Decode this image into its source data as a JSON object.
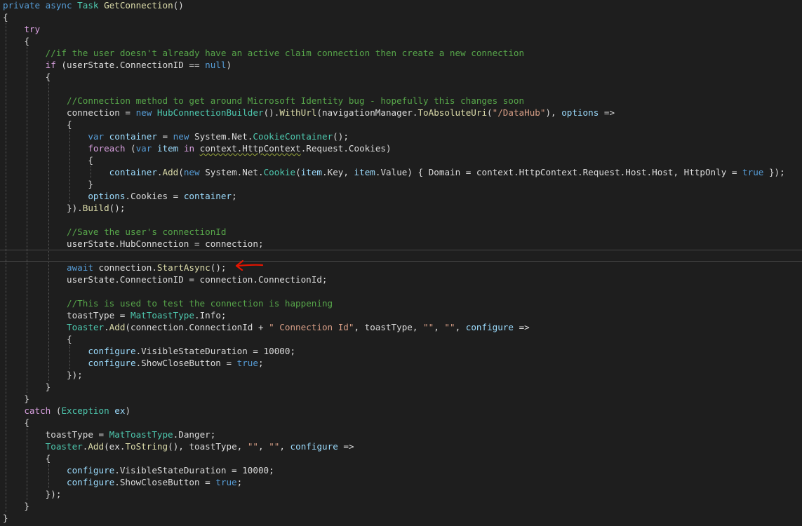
{
  "editor": {
    "colors": {
      "background": "#1e1e1e",
      "plain": "#dcdcdc",
      "keyword": "#569cd6",
      "control": "#d8a0df",
      "type": "#4ec9b0",
      "method": "#dcdcaa",
      "string": "#d69d85",
      "comment": "#57a64a",
      "param": "#9cdcfe",
      "local": "#9cdcfe",
      "number": "#b5cea8",
      "arrow": "#e51400"
    },
    "current_line_index": 21,
    "arrow_annotation": "red-arrow-pointing-left",
    "lines": [
      [
        [
          "private ",
          "keyword"
        ],
        [
          "async ",
          "keyword"
        ],
        [
          "Task ",
          "type"
        ],
        [
          "GetConnection",
          "method"
        ],
        [
          "()",
          "plain"
        ]
      ],
      [
        [
          "{",
          "plain"
        ]
      ],
      [
        [
          "    ",
          "plain"
        ],
        [
          "try",
          "control"
        ]
      ],
      [
        [
          "    {",
          "plain"
        ]
      ],
      [
        [
          "        ",
          "plain"
        ],
        [
          "//if the user doesn't already have an active claim connection then create a new connection",
          "comment"
        ]
      ],
      [
        [
          "        ",
          "plain"
        ],
        [
          "if",
          "control"
        ],
        [
          " (userState.ConnectionID == ",
          "plain"
        ],
        [
          "null",
          "keyword"
        ],
        [
          ")",
          "plain"
        ]
      ],
      [
        [
          "        {",
          "plain"
        ]
      ],
      [
        [
          "",
          "plain"
        ]
      ],
      [
        [
          "            ",
          "plain"
        ],
        [
          "//Connection method to get around Microsoft Identity bug - hopefully this changes soon",
          "comment"
        ]
      ],
      [
        [
          "            connection = ",
          "plain"
        ],
        [
          "new ",
          "keyword"
        ],
        [
          "HubConnectionBuilder",
          "type"
        ],
        [
          "().",
          "plain"
        ],
        [
          "WithUrl",
          "method"
        ],
        [
          "(navigationManager.",
          "plain"
        ],
        [
          "ToAbsoluteUri",
          "method"
        ],
        [
          "(",
          "plain"
        ],
        [
          "\"/DataHub\"",
          "string"
        ],
        [
          "), ",
          "plain"
        ],
        [
          "options",
          "param"
        ],
        [
          " =>",
          "plain"
        ]
      ],
      [
        [
          "            {",
          "plain"
        ]
      ],
      [
        [
          "                ",
          "plain"
        ],
        [
          "var ",
          "keyword"
        ],
        [
          "container",
          "local"
        ],
        [
          " = ",
          "plain"
        ],
        [
          "new ",
          "keyword"
        ],
        [
          "System.Net.",
          "plain"
        ],
        [
          "CookieContainer",
          "type"
        ],
        [
          "();",
          "plain"
        ]
      ],
      [
        [
          "                ",
          "plain"
        ],
        [
          "foreach",
          "control"
        ],
        [
          " (",
          "plain"
        ],
        [
          "var ",
          "keyword"
        ],
        [
          "item",
          "local"
        ],
        [
          " ",
          "plain"
        ],
        [
          "in",
          "control"
        ],
        [
          " ",
          "plain"
        ],
        [
          "context.HttpContext",
          "squiggle"
        ],
        [
          ".Request.Cookies)",
          "plain"
        ]
      ],
      [
        [
          "                {",
          "plain"
        ]
      ],
      [
        [
          "                    ",
          "plain"
        ],
        [
          "container",
          "local"
        ],
        [
          ".",
          "plain"
        ],
        [
          "Add",
          "method"
        ],
        [
          "(",
          "plain"
        ],
        [
          "new ",
          "keyword"
        ],
        [
          "System.Net.",
          "plain"
        ],
        [
          "Cookie",
          "type"
        ],
        [
          "(",
          "plain"
        ],
        [
          "item",
          "local"
        ],
        [
          ".Key, ",
          "plain"
        ],
        [
          "item",
          "local"
        ],
        [
          ".Value) { Domain = context.HttpContext.Request.Host.Host, HttpOnly = ",
          "plain"
        ],
        [
          "true",
          "keyword"
        ],
        [
          " });",
          "plain"
        ]
      ],
      [
        [
          "                }",
          "plain"
        ]
      ],
      [
        [
          "                ",
          "plain"
        ],
        [
          "options",
          "param"
        ],
        [
          ".Cookies = ",
          "plain"
        ],
        [
          "container",
          "local"
        ],
        [
          ";",
          "plain"
        ]
      ],
      [
        [
          "            }).",
          "plain"
        ],
        [
          "Build",
          "method"
        ],
        [
          "();",
          "plain"
        ]
      ],
      [
        [
          "",
          "plain"
        ]
      ],
      [
        [
          "            ",
          "plain"
        ],
        [
          "//Save the user's connectionId",
          "comment"
        ]
      ],
      [
        [
          "            userState.HubConnection = connection;",
          "plain"
        ]
      ],
      [
        [
          "",
          "plain"
        ]
      ],
      [
        [
          "            ",
          "plain"
        ],
        [
          "await",
          "keyword"
        ],
        [
          " connection.",
          "plain"
        ],
        [
          "StartAsync",
          "method"
        ],
        [
          "();",
          "plain"
        ]
      ],
      [
        [
          "            userState.ConnectionID = connection.ConnectionId;",
          "plain"
        ]
      ],
      [
        [
          "",
          "plain"
        ]
      ],
      [
        [
          "            ",
          "plain"
        ],
        [
          "//This is used to test the connection is happening",
          "comment"
        ]
      ],
      [
        [
          "            toastType = ",
          "plain"
        ],
        [
          "MatToastType",
          "type"
        ],
        [
          ".Info;",
          "plain"
        ]
      ],
      [
        [
          "            ",
          "plain"
        ],
        [
          "Toaster",
          "type"
        ],
        [
          ".",
          "plain"
        ],
        [
          "Add",
          "method"
        ],
        [
          "(connection.ConnectionId + ",
          "plain"
        ],
        [
          "\" Connection Id\"",
          "string"
        ],
        [
          ", toastType, ",
          "plain"
        ],
        [
          "\"\"",
          "string"
        ],
        [
          ", ",
          "plain"
        ],
        [
          "\"\"",
          "string"
        ],
        [
          ", ",
          "plain"
        ],
        [
          "configure",
          "param"
        ],
        [
          " =>",
          "plain"
        ]
      ],
      [
        [
          "            {",
          "plain"
        ]
      ],
      [
        [
          "                ",
          "plain"
        ],
        [
          "configure",
          "param"
        ],
        [
          ".VisibleStateDuration = 10000;",
          "plain"
        ]
      ],
      [
        [
          "                ",
          "plain"
        ],
        [
          "configure",
          "param"
        ],
        [
          ".ShowCloseButton = ",
          "plain"
        ],
        [
          "true",
          "keyword"
        ],
        [
          ";",
          "plain"
        ]
      ],
      [
        [
          "            });",
          "plain"
        ]
      ],
      [
        [
          "        }",
          "plain"
        ]
      ],
      [
        [
          "    }",
          "plain"
        ]
      ],
      [
        [
          "    ",
          "plain"
        ],
        [
          "catch",
          "control"
        ],
        [
          " (",
          "plain"
        ],
        [
          "Exception",
          "type"
        ],
        [
          " ",
          "plain"
        ],
        [
          "ex",
          "local"
        ],
        [
          ")",
          "plain"
        ]
      ],
      [
        [
          "    {",
          "plain"
        ]
      ],
      [
        [
          "        toastType = ",
          "plain"
        ],
        [
          "MatToastType",
          "type"
        ],
        [
          ".Danger;",
          "plain"
        ]
      ],
      [
        [
          "        ",
          "plain"
        ],
        [
          "Toaster",
          "type"
        ],
        [
          ".",
          "plain"
        ],
        [
          "Add",
          "method"
        ],
        [
          "(ex.",
          "plain"
        ],
        [
          "ToString",
          "method"
        ],
        [
          "(), toastType, ",
          "plain"
        ],
        [
          "\"\"",
          "string"
        ],
        [
          ", ",
          "plain"
        ],
        [
          "\"\"",
          "string"
        ],
        [
          ", ",
          "plain"
        ],
        [
          "configure",
          "param"
        ],
        [
          " =>",
          "plain"
        ]
      ],
      [
        [
          "        {",
          "plain"
        ]
      ],
      [
        [
          "            ",
          "plain"
        ],
        [
          "configure",
          "param"
        ],
        [
          ".VisibleStateDuration = 10000;",
          "plain"
        ]
      ],
      [
        [
          "            ",
          "plain"
        ],
        [
          "configure",
          "param"
        ],
        [
          ".ShowCloseButton = ",
          "plain"
        ],
        [
          "true",
          "keyword"
        ],
        [
          ";",
          "plain"
        ]
      ],
      [
        [
          "        });",
          "plain"
        ]
      ],
      [
        [
          "    }",
          "plain"
        ]
      ],
      [
        [
          "}",
          "plain"
        ]
      ]
    ]
  }
}
